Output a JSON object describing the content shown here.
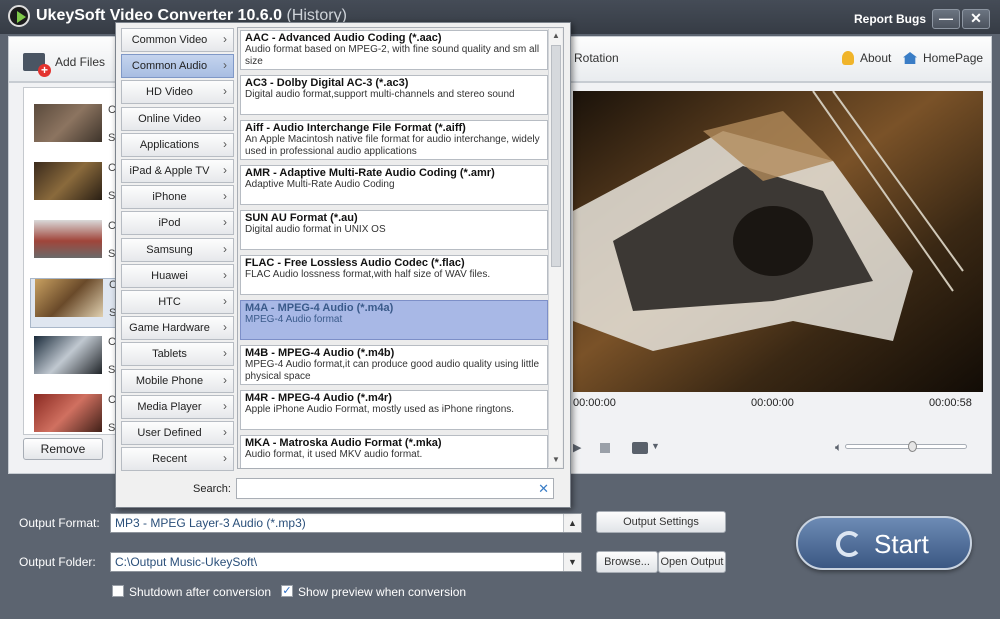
{
  "window": {
    "title": "UkeySoft Video Converter 10.6.0",
    "title_suffix": "(History)",
    "report_bugs": "Report Bugs",
    "minimize": "—",
    "close": "✕"
  },
  "toolbar": {
    "add_files": "Add Files",
    "rotation": "Rotation",
    "about": "About",
    "homepage": "HomePage"
  },
  "files": [
    {
      "ch": "Ch",
      "su": "Sul"
    },
    {
      "ch": "Ch",
      "su": "Sul"
    },
    {
      "ch": "Ch",
      "su": "Sul"
    },
    {
      "ch": "Ch",
      "su": "Sul"
    },
    {
      "ch": "Ch",
      "su": "Sul"
    },
    {
      "ch": "Ch",
      "su": "Sul"
    }
  ],
  "file_actions": {
    "remove": "Remove"
  },
  "player": {
    "time_left": "00:00:00",
    "time_mid": "00:00:00",
    "time_right": "00:00:58",
    "volume_level": 0.55
  },
  "format_popup": {
    "categories": [
      "Common Video",
      "Common Audio",
      "HD Video",
      "Online Video",
      "Applications",
      "iPad & Apple TV",
      "iPhone",
      "iPod",
      "Samsung",
      "Huawei",
      "HTC",
      "Game Hardware",
      "Tablets",
      "Mobile Phone",
      "Media Player",
      "User Defined",
      "Recent"
    ],
    "active_category": "Common Audio",
    "formats": [
      {
        "title": "AAC - Advanced Audio Coding (*.aac)",
        "desc": "Audio format based on MPEG-2, with fine sound quality and sm all size"
      },
      {
        "title": "AC3 - Dolby Digital AC-3 (*.ac3)",
        "desc": "Digital audio format,support multi-channels and stereo sound"
      },
      {
        "title": "Aiff - Audio Interchange File Format (*.aiff)",
        "desc": "An Apple Macintosh native file format for audio interchange, widely used in professional audio applications"
      },
      {
        "title": "AMR - Adaptive Multi-Rate Audio Coding (*.amr)",
        "desc": "Adaptive Multi-Rate Audio Coding"
      },
      {
        "title": "SUN AU Format (*.au)",
        "desc": "Digital audio format in UNIX OS"
      },
      {
        "title": "FLAC - Free Lossless Audio Codec (*.flac)",
        "desc": "FLAC Audio lossness format,with half size of WAV files."
      },
      {
        "title": "M4A - MPEG-4 Audio (*.m4a)",
        "desc": "MPEG-4 Audio format"
      },
      {
        "title": "M4B - MPEG-4 Audio (*.m4b)",
        "desc": "MPEG-4 Audio format,it can produce good audio quality using little physical space"
      },
      {
        "title": "M4R - MPEG-4 Audio (*.m4r)",
        "desc": "Apple iPhone Audio Format, mostly used as iPhone ringtons."
      },
      {
        "title": "MKA - Matroska Audio Format (*.mka)",
        "desc": "Audio format, it used MKV audio format."
      }
    ],
    "active_format_index": 6,
    "search_label": "Search:",
    "search_value": ""
  },
  "output": {
    "format_label": "Output Format:",
    "format_value": "MP3 - MPEG Layer-3 Audio (*.mp3)",
    "settings_button": "Output Settings",
    "folder_label": "Output Folder:",
    "folder_value": "C:\\Output Music-UkeySoft\\",
    "browse_button": "Browse...",
    "open_output_button": "Open Output",
    "start_button": "Start"
  },
  "options": {
    "shutdown_label": "Shutdown after conversion",
    "shutdown_checked": false,
    "preview_label": "Show preview when conversion",
    "preview_checked": true
  }
}
